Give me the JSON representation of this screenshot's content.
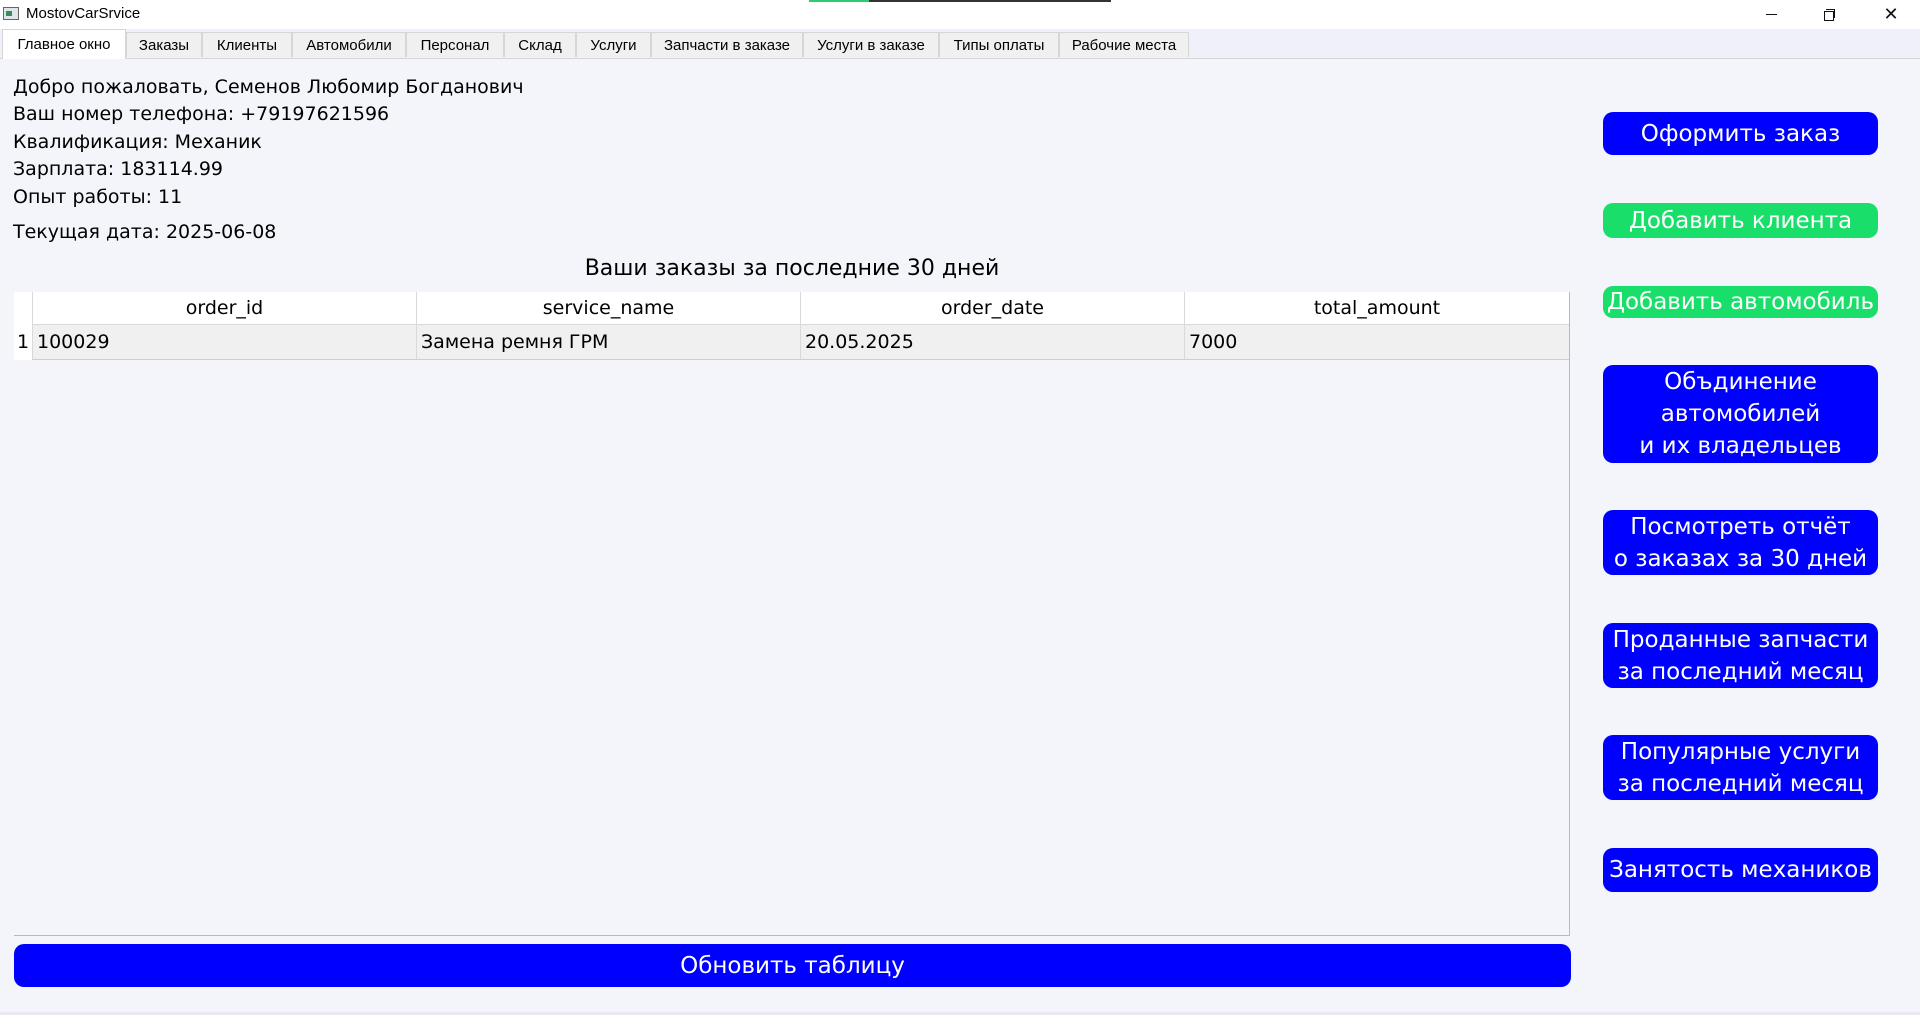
{
  "window": {
    "title": "MostovCarSrvice",
    "minimize_icon": "minimize-icon",
    "maximize_icon": "restore-icon",
    "close_icon": "close-icon"
  },
  "tabs": [
    {
      "label": "Главное окно",
      "active": true
    },
    {
      "label": "Заказы"
    },
    {
      "label": "Клиенты"
    },
    {
      "label": "Автомобили"
    },
    {
      "label": "Персонал"
    },
    {
      "label": "Склад"
    },
    {
      "label": "Услуги"
    },
    {
      "label": "Запчасти в заказе"
    },
    {
      "label": "Услуги в заказе"
    },
    {
      "label": "Типы оплаты"
    },
    {
      "label": "Рабочие места"
    }
  ],
  "profile": {
    "welcome": "Добро пожаловать, Семенов Любомир Богданович",
    "phone": "Ваш номер телефона: +79197621596",
    "qualification": "Квалификация: Механик",
    "salary": "Зарплата: 183114.99",
    "experience": "Опыт работы: 11",
    "current_date": "Текущая дата: 2025-06-08"
  },
  "orders": {
    "title": "Ваши заказы за последние 30 дней",
    "columns": [
      "order_id",
      "service_name",
      "order_date",
      "total_amount"
    ],
    "rows": [
      {
        "num": "1",
        "cells": [
          "100029",
          "Замена ремня ГРМ",
          "20.05.2025",
          "7000"
        ]
      }
    ]
  },
  "actions": {
    "refresh": "Обновить таблицу",
    "side": [
      "Оформить заказ",
      "Добавить клиента",
      "Добавить автомобиль",
      "Объдинение\nавтомобилей\nи их владельцев",
      "Посмотреть отчёт\nо заказах за 30 дней",
      "Проданные запчасти\nза последний месяц",
      "Популярные услуги\nза последний месяц",
      "Занятость механиков"
    ]
  },
  "colors": {
    "primary_button": "#0000ff",
    "secondary_button": "#19de6a",
    "panel_background": "#f4f5fa"
  }
}
